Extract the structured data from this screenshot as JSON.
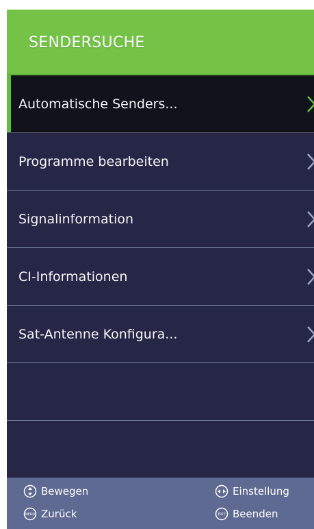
{
  "header": {
    "title": "SENDERSUCHE"
  },
  "menu": {
    "items": [
      {
        "label": "Automatische Senders..."
      },
      {
        "label": "Programme bearbeiten"
      },
      {
        "label": "Signalinformation"
      },
      {
        "label": "CI-Informationen"
      },
      {
        "label": "Sat-Antenne Konfigura..."
      }
    ]
  },
  "footer": {
    "move_label": "Bewegen",
    "adjust_label": "Einstellung",
    "back_label": "Zurück",
    "exit_label": "Beenden",
    "menu_key_text": "MENU",
    "exit_key_text": "EXIT"
  },
  "colors": {
    "header_green": "#74c347",
    "menu_background": "#262746",
    "selected_background": "#12121a",
    "footer_background": "#5e6a91",
    "accent": "#5fbf3f"
  },
  "icons": [
    "up-down-arrows-icon",
    "left-right-arrows-icon",
    "menu-key-icon",
    "exit-key-icon",
    "chevron-right-icon"
  ]
}
